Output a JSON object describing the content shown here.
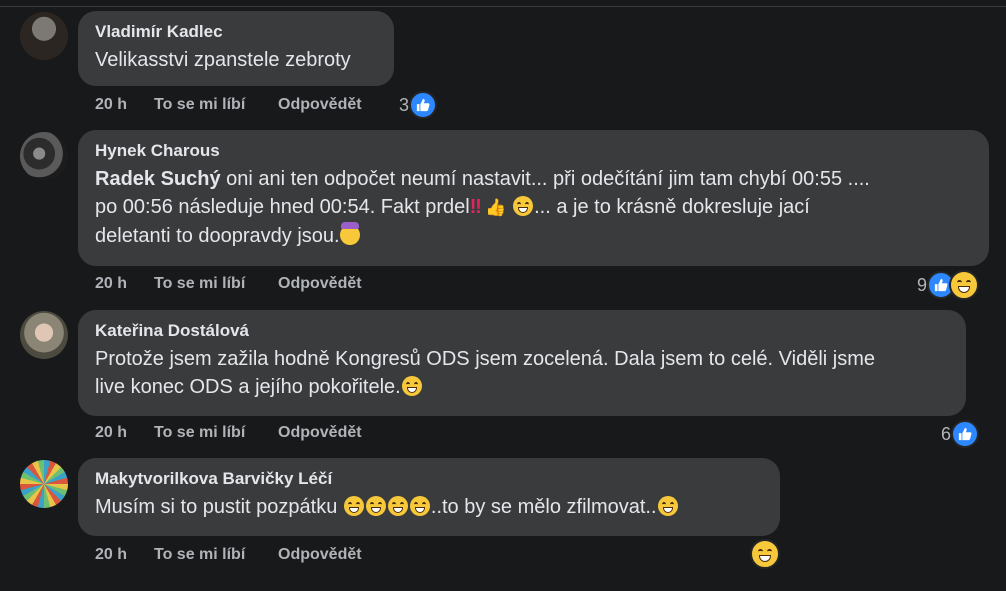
{
  "comments": [
    {
      "author": "Vladimír Kadlec",
      "text": "Velikasstvi zpanstele zebroty",
      "time": "20 h",
      "like": "To se mi líbí",
      "reply": "Odpovědět",
      "reaction_count": "3",
      "avatar_colors": [
        "#6d6a66",
        "#2b2622"
      ]
    },
    {
      "author": "Hynek Charous",
      "mention": "Radek Suchý",
      "text_1": " oni ani ten odpočet neumí nastavit... při odečítání jim tam chybí 00:55 ....",
      "text_2": "po 00:56 následuje hned 00:54. Fakt prdel",
      "text_2b": "... a je to krásně dokresluje jací",
      "text_3": "deletanti to doopravdy jsou.",
      "bang": "‼",
      "thumb": "👍",
      "time": "20 h",
      "like": "To se mi líbí",
      "reply": "Odpovědět",
      "reaction_count": "9",
      "avatar_colors": [
        "#4a4a4a",
        "#1c1c1c"
      ]
    },
    {
      "author": "Kateřina Dostálová",
      "text_1": "Protože jsem zažila hodně Kongresů ODS jsem zocelená. Dala jsem to celé. Viděli jsme",
      "text_2": "live konec ODS a jejího pokořitele.",
      "time": "20 h",
      "like": "To se mi líbí",
      "reply": "Odpovědět",
      "reaction_count": "6",
      "avatar_colors": [
        "#8b8575",
        "#4d4a40"
      ]
    },
    {
      "author": "Makytvorilkova Barvičky Léčí",
      "text_1": "Musím si to pustit pozpátku ",
      "text_2": "..to by se mělo zfilmovat..",
      "time": "20 h",
      "like": "To se mi líbí",
      "reply": "Odpovědět",
      "avatar_colors": [
        "#3aa2c9",
        "#d9563f"
      ]
    }
  ],
  "colors": {
    "background": "#18191a",
    "bubble": "#3a3b3c",
    "like_blue": "#2d88ff",
    "secondary_text": "#b0b3b8"
  }
}
